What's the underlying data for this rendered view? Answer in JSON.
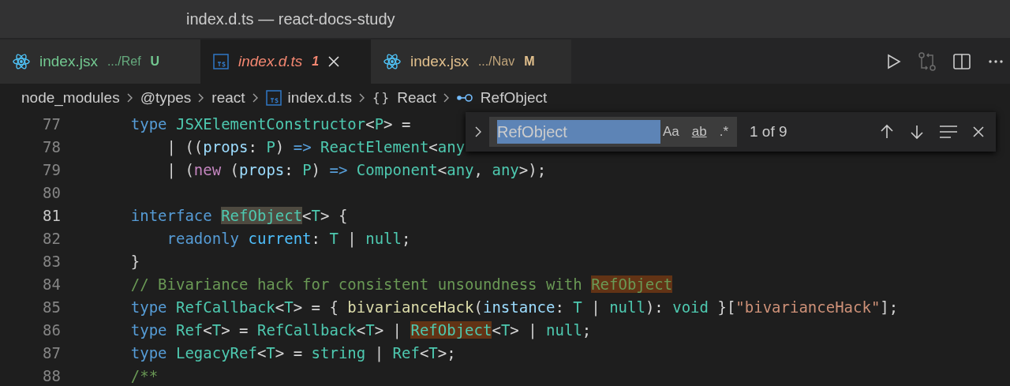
{
  "window": {
    "title": "index.d.ts — react-docs-study"
  },
  "tabs": [
    {
      "kind": "jsx",
      "name": "index.jsx",
      "path": ".../Ref",
      "status": "U",
      "color": "#73c991",
      "selected": false,
      "preview": false,
      "closable": false
    },
    {
      "kind": "ts",
      "name": "index.d.ts",
      "status": "1",
      "color": "#f48771",
      "selected": true,
      "preview": true,
      "closable": true
    },
    {
      "kind": "jsx",
      "name": "index.jsx",
      "path": ".../Nav",
      "status": "M",
      "color": "#e2c08d",
      "selected": false,
      "preview": false,
      "closable": false
    }
  ],
  "breadcrumbs": [
    {
      "kind": "folder",
      "label": "node_modules"
    },
    {
      "kind": "folder",
      "label": "@types"
    },
    {
      "kind": "folder",
      "label": "react"
    },
    {
      "kind": "ts",
      "label": "index.d.ts"
    },
    {
      "kind": "module",
      "glyph": "{}",
      "label": "React"
    },
    {
      "kind": "symbol",
      "label": "RefObject"
    }
  ],
  "find": {
    "value": "RefObject",
    "toggles": [
      {
        "label": "Aa",
        "on": false
      },
      {
        "label": "ab",
        "on": false
      },
      {
        "label": ".*",
        "on": false
      }
    ],
    "count": "1 of 9"
  },
  "editor": {
    "lines": [
      {
        "number": "77",
        "active": false,
        "tokens": [
          {
            "text": "    type ",
            "kind": "keyword"
          },
          {
            "text": "JSXElementConstructor",
            "kind": "type"
          },
          {
            "text": "<",
            "kind": "punct"
          },
          {
            "text": "P",
            "kind": "type"
          },
          {
            "text": "> =",
            "kind": "punct"
          }
        ]
      },
      {
        "number": "78",
        "active": false,
        "tokens": [
          {
            "text": "        | ((",
            "kind": "punct"
          },
          {
            "text": "props",
            "kind": "param"
          },
          {
            "text": ": ",
            "kind": "punct"
          },
          {
            "text": "P",
            "kind": "type"
          },
          {
            "text": ") ",
            "kind": "punct"
          },
          {
            "text": "=> ",
            "kind": "keyword"
          },
          {
            "text": "ReactElement",
            "kind": "type"
          },
          {
            "text": "<",
            "kind": "punct"
          },
          {
            "text": "any",
            "kind": "type"
          }
        ]
      },
      {
        "number": "79",
        "active": false,
        "tokens": [
          {
            "text": "        | (",
            "kind": "punct"
          },
          {
            "text": "new",
            "kind": "control"
          },
          {
            "text": " (",
            "kind": "punct"
          },
          {
            "text": "props",
            "kind": "param"
          },
          {
            "text": ": ",
            "kind": "punct"
          },
          {
            "text": "P",
            "kind": "type"
          },
          {
            "text": ") ",
            "kind": "punct"
          },
          {
            "text": "=> ",
            "kind": "keyword"
          },
          {
            "text": "Component",
            "kind": "type"
          },
          {
            "text": "<",
            "kind": "punct"
          },
          {
            "text": "any",
            "kind": "type"
          },
          {
            "text": ", ",
            "kind": "punct"
          },
          {
            "text": "any",
            "kind": "type"
          },
          {
            "text": ">);",
            "kind": "punct"
          }
        ]
      },
      {
        "number": "80",
        "active": false
      },
      {
        "number": "81",
        "active": true,
        "tokens": [
          {
            "text": "    interface ",
            "kind": "keyword"
          },
          {
            "text": "RefObject",
            "kind": "type",
            "find_match": true,
            "current_match": true
          },
          {
            "text": "<",
            "kind": "punct"
          },
          {
            "text": "T",
            "kind": "type"
          },
          {
            "text": "> {",
            "kind": "punct"
          }
        ]
      },
      {
        "number": "82",
        "active": false,
        "tokens": [
          {
            "text": "        readonly ",
            "kind": "keyword"
          },
          {
            "text": "current",
            "kind": "prop"
          },
          {
            "text": ": ",
            "kind": "punct"
          },
          {
            "text": "T",
            "kind": "type"
          },
          {
            "text": " | ",
            "kind": "punct"
          },
          {
            "text": "null",
            "kind": "type"
          },
          {
            "text": ";",
            "kind": "punct"
          }
        ]
      },
      {
        "number": "83",
        "active": false,
        "tokens": [
          {
            "text": "    }",
            "kind": "punct"
          }
        ]
      },
      {
        "number": "84",
        "active": false,
        "tokens": [
          {
            "text": "    // Bivariance hack for consistent unsoundness with ",
            "kind": "comment"
          },
          {
            "text": "RefObject",
            "kind": "comment",
            "find_match": true,
            "current_match": false
          }
        ]
      },
      {
        "number": "85",
        "active": false,
        "tokens": [
          {
            "text": "    type ",
            "kind": "keyword"
          },
          {
            "text": "RefCallback",
            "kind": "type"
          },
          {
            "text": "<",
            "kind": "punct"
          },
          {
            "text": "T",
            "kind": "type"
          },
          {
            "text": "> = { ",
            "kind": "punct"
          },
          {
            "text": "bivarianceHack",
            "kind": "func"
          },
          {
            "text": "(",
            "kind": "punct"
          },
          {
            "text": "instance",
            "kind": "param"
          },
          {
            "text": ": ",
            "kind": "punct"
          },
          {
            "text": "T",
            "kind": "type"
          },
          {
            "text": " | ",
            "kind": "punct"
          },
          {
            "text": "null",
            "kind": "type"
          },
          {
            "text": "): ",
            "kind": "punct"
          },
          {
            "text": "void",
            "kind": "type"
          },
          {
            "text": " }[",
            "kind": "punct"
          },
          {
            "text": "\"bivarianceHack\"",
            "kind": "string"
          },
          {
            "text": "];",
            "kind": "punct"
          }
        ]
      },
      {
        "number": "86",
        "active": false,
        "tokens": [
          {
            "text": "    type ",
            "kind": "keyword"
          },
          {
            "text": "Ref",
            "kind": "type"
          },
          {
            "text": "<",
            "kind": "punct"
          },
          {
            "text": "T",
            "kind": "type"
          },
          {
            "text": "> = ",
            "kind": "punct"
          },
          {
            "text": "RefCallback",
            "kind": "type"
          },
          {
            "text": "<",
            "kind": "punct"
          },
          {
            "text": "T",
            "kind": "type"
          },
          {
            "text": "> | ",
            "kind": "punct"
          },
          {
            "text": "RefObject",
            "kind": "type",
            "find_match": true,
            "current_match": false
          },
          {
            "text": "<",
            "kind": "punct"
          },
          {
            "text": "T",
            "kind": "type"
          },
          {
            "text": "> | ",
            "kind": "punct"
          },
          {
            "text": "null",
            "kind": "type"
          },
          {
            "text": ";",
            "kind": "punct"
          }
        ]
      },
      {
        "number": "87",
        "active": false,
        "tokens": [
          {
            "text": "    type ",
            "kind": "keyword"
          },
          {
            "text": "LegacyRef",
            "kind": "type"
          },
          {
            "text": "<",
            "kind": "punct"
          },
          {
            "text": "T",
            "kind": "type"
          },
          {
            "text": "> = ",
            "kind": "punct"
          },
          {
            "text": "string",
            "kind": "type"
          },
          {
            "text": " | ",
            "kind": "punct"
          },
          {
            "text": "Ref",
            "kind": "type"
          },
          {
            "text": "<",
            "kind": "punct"
          },
          {
            "text": "T",
            "kind": "type"
          },
          {
            "text": ">;",
            "kind": "punct"
          }
        ]
      },
      {
        "number": "88",
        "active": false,
        "tokens": [
          {
            "text": "    /**",
            "kind": "comment"
          }
        ]
      }
    ]
  }
}
